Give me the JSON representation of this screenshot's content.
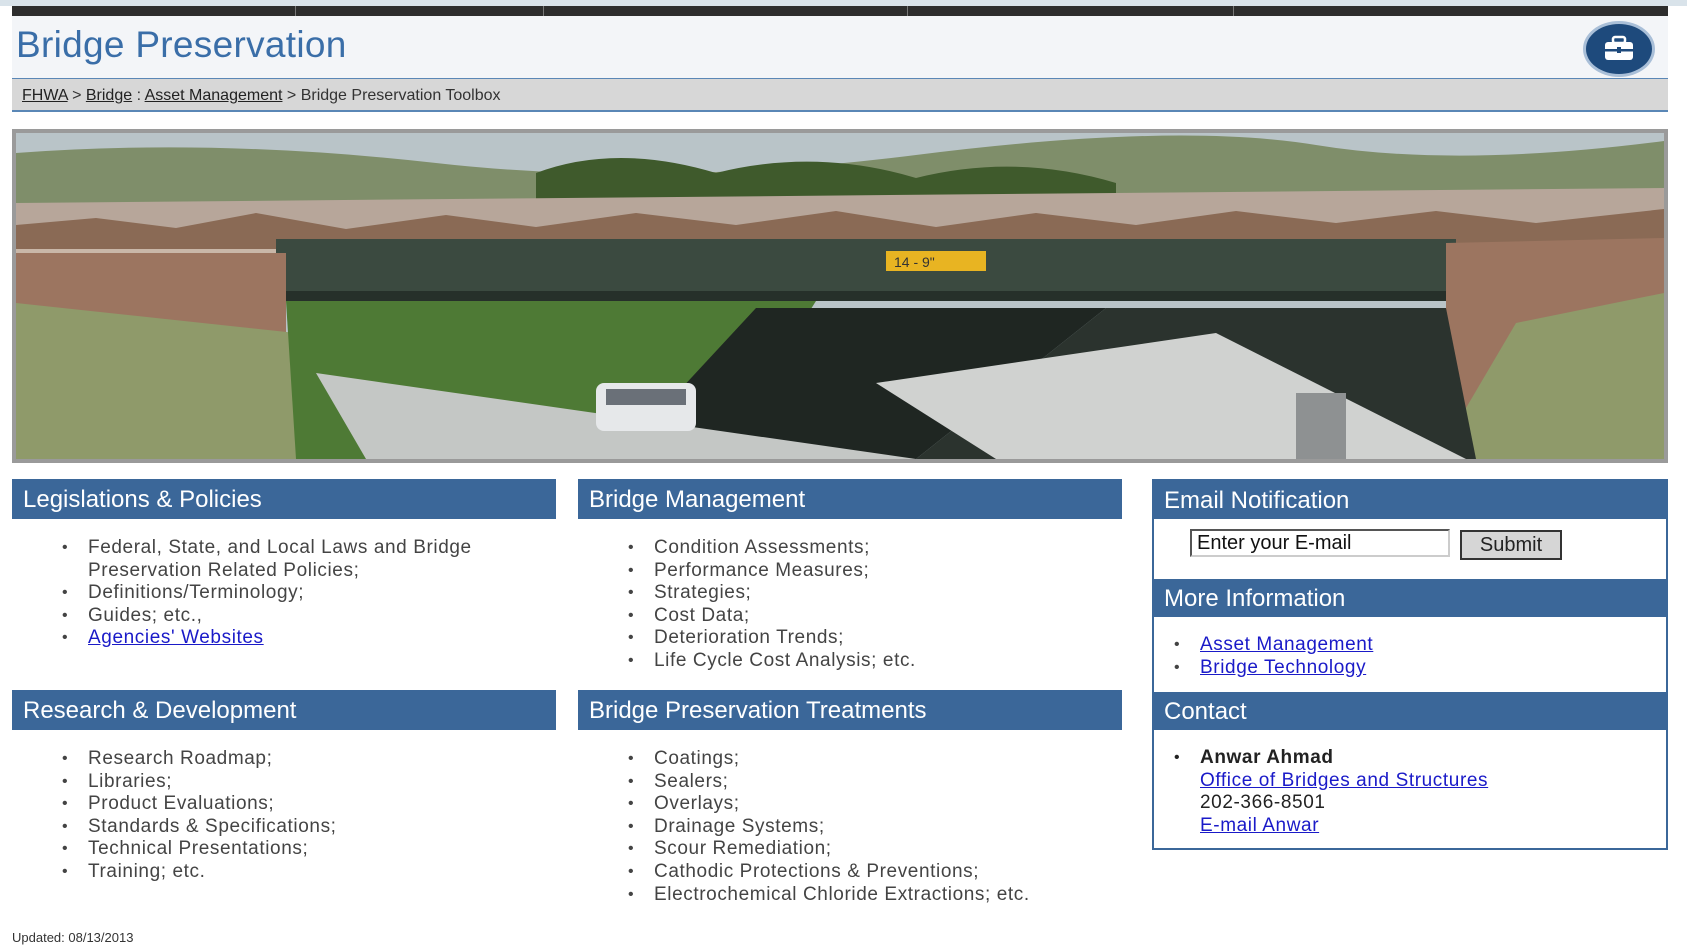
{
  "header": {
    "title": "Bridge Preservation",
    "toolbox_icon": "toolbox-icon"
  },
  "breadcrumb": {
    "items": [
      "FHWA",
      "Bridge",
      "Asset Management",
      "Bridge Preservation Toolbox"
    ],
    "separators": [
      ">",
      ":",
      ">"
    ]
  },
  "hero": {
    "sign_text": "14 - 9\""
  },
  "panels": {
    "legislations": {
      "title": "Legislations & Policies",
      "items": [
        "Federal, State, and Local Laws and Bridge Preservation Related Policies;",
        "Definitions/Terminology;",
        "Guides; etc.,"
      ],
      "link": "Agencies' Websites"
    },
    "management": {
      "title": "Bridge Management",
      "items": [
        "Condition Assessments;",
        "Performance Measures;",
        "Strategies;",
        "Cost Data;",
        "Deterioration Trends;",
        "Life Cycle Cost Analysis; etc."
      ]
    },
    "research": {
      "title": "Research & Development",
      "items": [
        "Research Roadmap;",
        "Libraries;",
        "Product Evaluations;",
        "Standards & Specifications;",
        "Technical Presentations;",
        "Training; etc."
      ]
    },
    "treatments": {
      "title": "Bridge Preservation Treatments",
      "items": [
        "Coatings;",
        "Sealers;",
        "Overlays;",
        "Drainage Systems;",
        "Scour Remediation;",
        "Cathodic Protections & Preventions;",
        "Electrochemical Chloride Extractions; etc."
      ]
    }
  },
  "sidebar": {
    "email": {
      "title": "Email Notification",
      "placeholder": "Enter your E-mail",
      "submit": "Submit"
    },
    "more_info": {
      "title": "More Information",
      "links": [
        "Asset Management",
        "Bridge Technology"
      ]
    },
    "contact": {
      "title": "Contact",
      "name": "Anwar Ahmad",
      "office": "Office of Bridges and Structures",
      "phone": "202-366-8501",
      "email_link": "E-mail Anwar"
    }
  },
  "footer": {
    "updated": "Updated: 08/13/2013"
  },
  "colors": {
    "panel_header": "#3b6799",
    "title": "#3a6ea8",
    "link": "#1a1ac8",
    "toolbox": "#1e4a7c"
  }
}
